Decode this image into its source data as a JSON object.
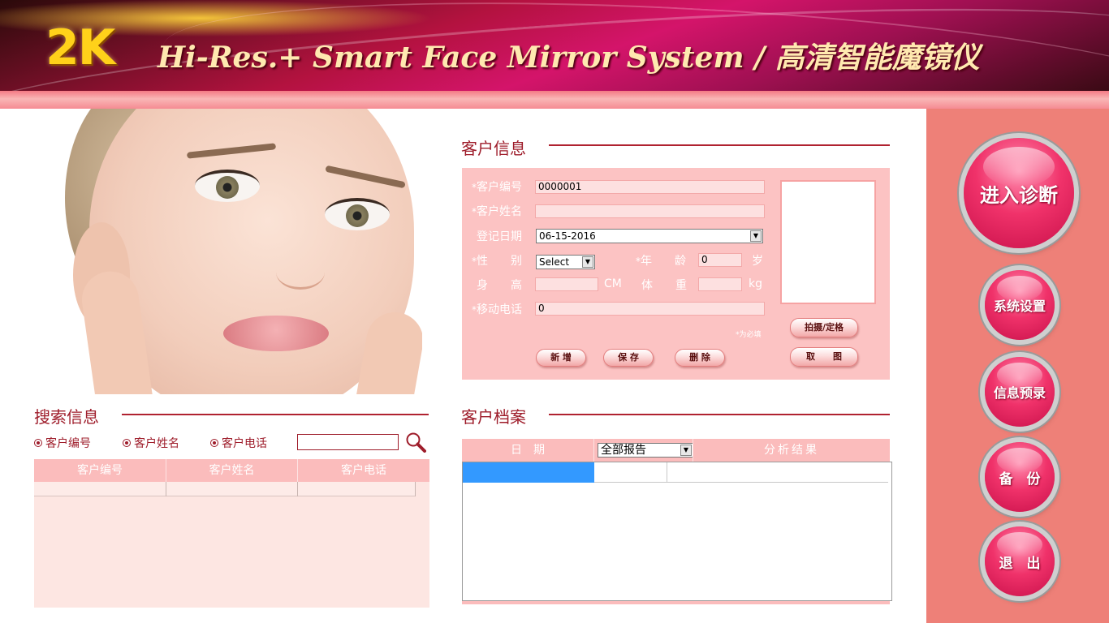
{
  "header": {
    "logo": "2K",
    "title": "Hi-Res.+ Smart Face Mirror System / 高清智能魔镜仪"
  },
  "sidebar": {
    "enter_diagnosis": "进入诊断",
    "system_settings": "系统设置",
    "info_preentry": "信息预录",
    "backup": "备　份",
    "exit": "退　出"
  },
  "customer_info": {
    "title": "客户信息",
    "id_label": "客户编号",
    "id_value": "0000001",
    "name_label": "客户姓名",
    "name_value": "",
    "date_label": "登记日期",
    "date_value": "06-15-2016",
    "gender_label": "性　　别",
    "gender_value": "Select",
    "age_label": "年　　龄",
    "age_value": "0",
    "age_unit": "岁",
    "height_label": "身　　高",
    "height_value": "",
    "height_unit": "CM",
    "weight_label": "体　　重",
    "weight_value": "",
    "weight_unit": "kg",
    "phone_label": "移动电话",
    "phone_value": "0",
    "required_star": "*",
    "required_note": "*为必填",
    "btn_add": "新 增",
    "btn_save": "保 存",
    "btn_delete": "删 除",
    "btn_capture": "拍摄/定格",
    "btn_take": "取　　图"
  },
  "search": {
    "title": "搜索信息",
    "radio_id": "客户编号",
    "radio_name": "客户姓名",
    "radio_phone": "客户电话",
    "input_value": "",
    "columns": [
      "客户编号",
      "客户姓名",
      "客户电话"
    ]
  },
  "archive": {
    "title": "客户档案",
    "col_date": "日　期",
    "filter_value": "全部报告",
    "col_result": "分析结果"
  },
  "colors": {
    "accent": "#9e1c2a",
    "panel": "#fcc3c3",
    "sidebar": "#ee8078",
    "selection": "#3399ff"
  },
  "icons": [
    "search-icon",
    "dropdown-arrow-icon"
  ]
}
